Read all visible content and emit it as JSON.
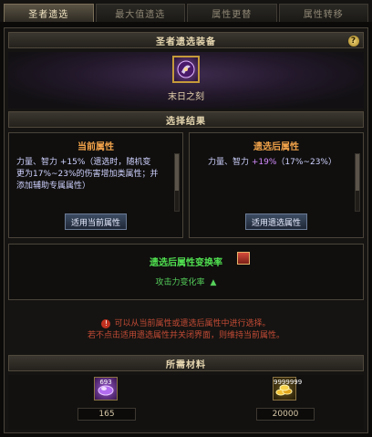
{
  "tabs": [
    {
      "label": "圣者遗选"
    },
    {
      "label": "最大值遗选"
    },
    {
      "label": "属性更替"
    },
    {
      "label": "属性转移"
    }
  ],
  "equip_section": {
    "title": "圣者遗选装备",
    "help": "?",
    "item_name": "末日之刻"
  },
  "result_section": {
    "title": "选择结果",
    "current": {
      "title": "当前属性",
      "line1": "力量、智力 +15%（遗选时，随机变",
      "line2": "更为17%~23%的伤害增加类属性；并",
      "line3": "添加辅助专属属性）",
      "button": "适用当前属性"
    },
    "after": {
      "title": "遗选后属性",
      "text_prefix": "力量、智力 ",
      "pct": "+19%",
      "text_suffix": "（17%~23%）",
      "button": "适用遗选属性"
    }
  },
  "conversion": {
    "title": "遗选后属性变换率",
    "label": "攻击力变化率",
    "arrow": "▲"
  },
  "notice": {
    "line1": "可以从当前属性或遗选后属性中进行选择。",
    "line2": "若不点击适用遗选属性并关闭界面，则维持当前属性。"
  },
  "materials": {
    "title": "所需材料",
    "items": [
      {
        "icon": "purple-shard-icon",
        "badge": "693",
        "value": "165"
      },
      {
        "icon": "gold-coins-icon",
        "badge": "9999999",
        "value": "20000"
      }
    ]
  },
  "colors": {
    "accent_orange": "#f0a24a",
    "green": "#50e050",
    "warning_red": "#c34b35",
    "item_purple": "#d58cff"
  }
}
